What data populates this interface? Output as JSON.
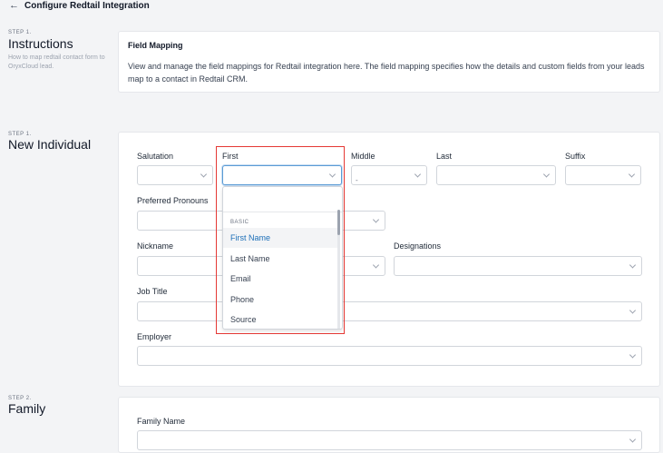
{
  "header": {
    "back_icon": "←",
    "title": "Configure Redtail Integration"
  },
  "step1": {
    "step_label": "STEP 1.",
    "title": "Instructions",
    "description": "How to map redtail contact form to OryxCloud lead."
  },
  "field_mapping": {
    "title": "Field Mapping",
    "text": "View and manage the field mappings for Redtail integration here. The field mapping specifies how the details and custom fields from your leads map to a contact in Redtail CRM."
  },
  "step_individual": {
    "step_label": "STEP 1.",
    "title": "New Individual",
    "labels": {
      "salutation": "Salutation",
      "first": "First",
      "middle": "Middle",
      "last": "Last",
      "suffix": "Suffix",
      "preferred_pronouns": "Preferred Pronouns",
      "nickname": "Nickname",
      "designations": "Designations",
      "job_title": "Job Title",
      "employer": "Employer"
    },
    "middle_value": "-"
  },
  "dropdown": {
    "search_value": "",
    "group_label": "BASIC",
    "items": [
      "First Name",
      "Last Name",
      "Email",
      "Phone",
      "Source"
    ],
    "selected": "First Name"
  },
  "step_family": {
    "step_label": "STEP 2.",
    "title": "Family",
    "labels": {
      "family_name": "Family Name"
    }
  },
  "colors": {
    "highlight_border": "#e53935",
    "active_item_text": "#1d6fb8",
    "focus_border": "#5b9bd5"
  }
}
